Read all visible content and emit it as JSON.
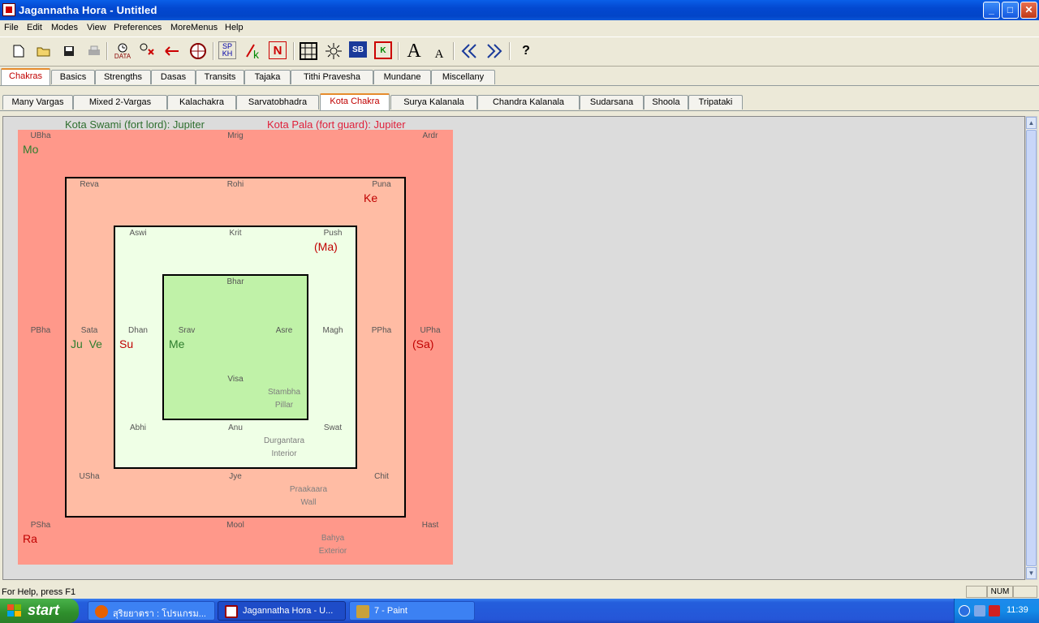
{
  "window": {
    "title": "Jagannatha Hora - Untitled"
  },
  "menu": [
    "File",
    "Edit",
    "Modes",
    "View",
    "Preferences",
    "MoreMenus",
    "Help"
  ],
  "toolbar": {
    "sp_label": "SP\nKH",
    "data_label": "DATA",
    "n_label": "N",
    "sb_label": "SB",
    "k_label": "K",
    "big_a": "A",
    "small_a": "A",
    "help": "?"
  },
  "tabs_main": [
    "Chakras",
    "Basics",
    "Strengths",
    "Dasas",
    "Transits",
    "Tajaka",
    "Tithi Pravesha",
    "Mundane",
    "Miscellany"
  ],
  "tabs_sub": [
    "Many Vargas",
    "Mixed 2-Vargas",
    "Kalachakra",
    "Sarvatobhadra",
    "Kota Chakra",
    "Surya Kalanala",
    "Chandra Kalanala",
    "Sudarsana",
    "Shoola",
    "Tripataki"
  ],
  "kota": {
    "swami": "Kota Swami (fort lord): Jupiter",
    "pala": "Kota Pala (fort guard): Jupiter",
    "nakshatras": [
      "UBha",
      "Mrig",
      "Ardr",
      "Reva",
      "Rohi",
      "Puna",
      "Aswi",
      "Krit",
      "Push",
      "Bhar",
      "PBha",
      "Sata",
      "Dhan",
      "Srav",
      "Asre",
      "Magh",
      "PPha",
      "UPha",
      "Visa",
      "Abhi",
      "Anu",
      "Swat",
      "USha",
      "Jye",
      "Chit",
      "PSha",
      "Mool",
      "Hast"
    ],
    "planets": {
      "mo": "Mo",
      "ke": "Ke",
      "ma": "(Ma)",
      "ju_ve": "Ju  Ve",
      "su": "Su",
      "me": "Me",
      "sa": "(Sa)",
      "ra": "Ra"
    },
    "zones": {
      "stambha": "Stambha",
      "pillar": "Pillar",
      "durgantara": "Durgantara",
      "interior": "Interior",
      "praakaara": "Praakaara",
      "wall": "Wall",
      "bahya": "Bahya",
      "exterior": "Exterior"
    }
  },
  "status": {
    "help_text": "For Help, press F1",
    "num": "NUM"
  },
  "taskbar": {
    "start": "start",
    "tasks": [
      "สุริยยาตรา : โปรแกรม...",
      "Jagannatha Hora - U...",
      "7 - Paint"
    ],
    "clock": "11:39"
  }
}
